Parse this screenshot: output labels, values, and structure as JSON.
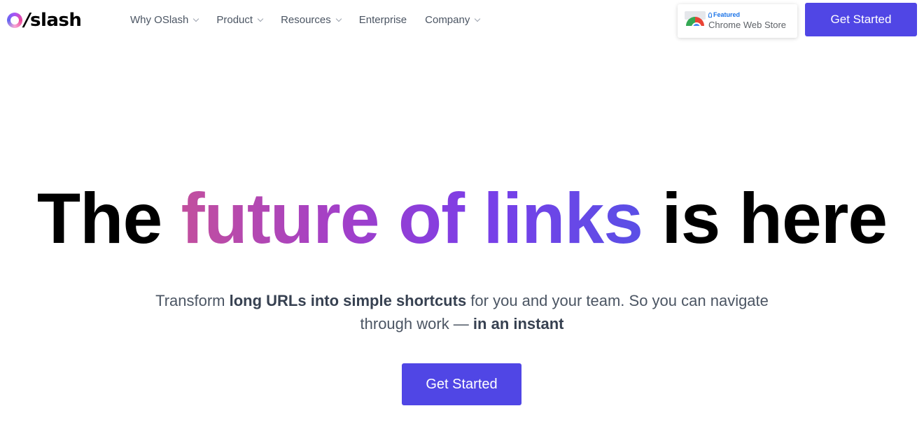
{
  "brand": {
    "logo_text": "slash"
  },
  "nav": {
    "items": [
      {
        "label": "Why OSlash",
        "has_dropdown": true
      },
      {
        "label": "Product",
        "has_dropdown": true
      },
      {
        "label": "Resources",
        "has_dropdown": true
      },
      {
        "label": "Enterprise",
        "has_dropdown": false
      },
      {
        "label": "Company",
        "has_dropdown": true
      }
    ]
  },
  "badge": {
    "featured": "Featured",
    "store": "Chrome Web Store"
  },
  "header_cta": "Get Started",
  "hero": {
    "title_start": "The ",
    "title_highlight": "future of links",
    "title_end": " is here",
    "sub_1": "Transform ",
    "sub_bold_1": "long URLs into simple shortcuts",
    "sub_2": " for you and your team. So you can navigate through work — ",
    "sub_bold_2": "in an instant",
    "cta": "Get Started"
  },
  "colors": {
    "primary": "#5046e5",
    "gradient_start": "#c24f9e",
    "gradient_end": "#5a4fe6"
  }
}
